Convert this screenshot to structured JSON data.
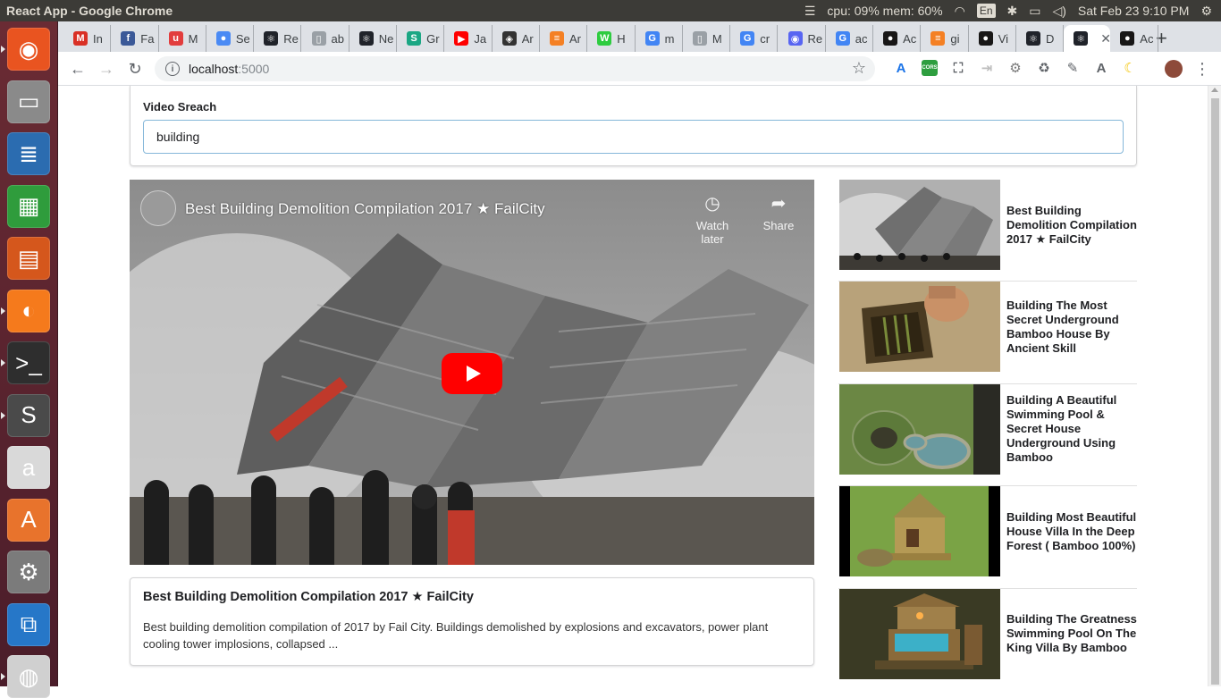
{
  "os": {
    "window_title": "React App - Google Chrome",
    "cpu_mem": "cpu: 09% mem: 60%",
    "keyboard_lang": "En",
    "datetime": "Sat Feb 23  9:10 PM"
  },
  "launcher": [
    {
      "name": "ubuntu-dash",
      "glyph": "◉",
      "color": "#e95420"
    },
    {
      "name": "files",
      "glyph": "▭",
      "color": "#8a8a8a"
    },
    {
      "name": "libreoffice-writer",
      "glyph": "≣",
      "color": "#2b6cb0"
    },
    {
      "name": "libreoffice-calc",
      "glyph": "▦",
      "color": "#2f9c3c"
    },
    {
      "name": "libreoffice-impress",
      "glyph": "▤",
      "color": "#d5571c"
    },
    {
      "name": "firefox",
      "glyph": "◐",
      "color": "#f57a1c"
    },
    {
      "name": "terminal",
      "glyph": ">_",
      "color": "#2e2e2e"
    },
    {
      "name": "sublime-text",
      "glyph": "S",
      "color": "#4a4a4a"
    },
    {
      "name": "amazon",
      "glyph": "a",
      "color": "#d9d9d9"
    },
    {
      "name": "software-center",
      "glyph": "A",
      "color": "#e8732c"
    },
    {
      "name": "system-settings",
      "glyph": "⚙",
      "color": "#7b7b7b"
    },
    {
      "name": "vscode",
      "glyph": "⧉",
      "color": "#2677c8"
    },
    {
      "name": "chrome",
      "glyph": "◍",
      "color": "#d0d0d0"
    }
  ],
  "tabs": [
    {
      "label": "In",
      "fav": "M",
      "color": "#d93025"
    },
    {
      "label": "Fa",
      "fav": "f",
      "color": "#3b5998"
    },
    {
      "label": "M",
      "fav": "u",
      "color": "#e23d3d"
    },
    {
      "label": "Se",
      "fav": "●",
      "color": "#4a8af4"
    },
    {
      "label": "Re",
      "fav": "⚛",
      "color": "#20232a"
    },
    {
      "label": "ab",
      "fav": "▯",
      "color": "#9aa0a6"
    },
    {
      "label": "Ne",
      "fav": "⚛",
      "color": "#20232a"
    },
    {
      "label": "Gr",
      "fav": "S",
      "color": "#1ba784"
    },
    {
      "label": "Ja",
      "fav": "▶",
      "color": "#f00"
    },
    {
      "label": "Ar",
      "fav": "◈",
      "color": "#333"
    },
    {
      "label": "Ar",
      "fav": "≡",
      "color": "#f48024"
    },
    {
      "label": "H",
      "fav": "W",
      "color": "#2ecc40"
    },
    {
      "label": "m",
      "fav": "G",
      "color": "#4285f4"
    },
    {
      "label": "M",
      "fav": "▯",
      "color": "#9aa0a6"
    },
    {
      "label": "cr",
      "fav": "G",
      "color": "#4285f4"
    },
    {
      "label": "Re",
      "fav": "◉",
      "color": "#5865f2"
    },
    {
      "label": "ac",
      "fav": "G",
      "color": "#4285f4"
    },
    {
      "label": "Ac",
      "fav": "●",
      "color": "#181717"
    },
    {
      "label": "gi",
      "fav": "≡",
      "color": "#f48024"
    },
    {
      "label": "Vi",
      "fav": "●",
      "color": "#181717"
    },
    {
      "label": "D",
      "fav": "⚛",
      "color": "#20232a"
    },
    {
      "label": "",
      "fav": "⚛",
      "color": "#20232a",
      "active": true
    },
    {
      "label": "Ac",
      "fav": "●",
      "color": "#181717"
    }
  ],
  "toolbar": {
    "url_host": "localhost",
    "url_port": ":5000",
    "extensions": [
      {
        "name": "translate-extension",
        "glyph": "A",
        "color": "#1a73e8"
      },
      {
        "name": "cors-extension",
        "glyph": "CORS",
        "color": "#2e9e3f"
      },
      {
        "name": "screenshot-extension",
        "glyph": "⛶",
        "color": "#5f6368"
      },
      {
        "name": "share-extension",
        "glyph": "⇥",
        "color": "#bdbdbd"
      },
      {
        "name": "react-devtools-extension",
        "glyph": "⚙",
        "color": "#7a7a7a"
      },
      {
        "name": "recycle-extension",
        "glyph": "♻",
        "color": "#5f6368"
      },
      {
        "name": "eyedropper-extension",
        "glyph": "✎",
        "color": "#5f6368"
      },
      {
        "name": "shield-extension",
        "glyph": "A",
        "color": "#5f6368"
      },
      {
        "name": "moon-extension",
        "glyph": "☾",
        "color": "#f5c400"
      }
    ]
  },
  "search": {
    "label": "Video Sreach",
    "value": "building"
  },
  "player": {
    "title": "Best Building Demolition Compilation 2017 ★ FailCity",
    "watch_later": "Watch later",
    "share": "Share"
  },
  "detail": {
    "title": "Best Building Demolition Compilation 2017 ★ FailCity",
    "description": "Best building demolition compilation of 2017 by Fail City. Buildings demolished by explosions and excavators, power plant cooling tower implosions, collapsed ..."
  },
  "videos": [
    {
      "title": "Best Building Demolition Compilation 2017 ★ FailCity",
      "thumb": "demolition"
    },
    {
      "title": "Building The Most Secret Underground Bamboo House By Ancient Skill",
      "thumb": "underground"
    },
    {
      "title": "Building A Beautiful Swimming Pool & Secret House Underground Using Bamboo",
      "thumb": "pool-grass"
    },
    {
      "title": "Building Most Beautiful House Villa In the Deep Forest ( Bamboo 100%)",
      "thumb": "villa"
    },
    {
      "title": "Building The Greatness Swimming Pool On The King Villa By Bamboo",
      "thumb": "king-villa"
    }
  ]
}
